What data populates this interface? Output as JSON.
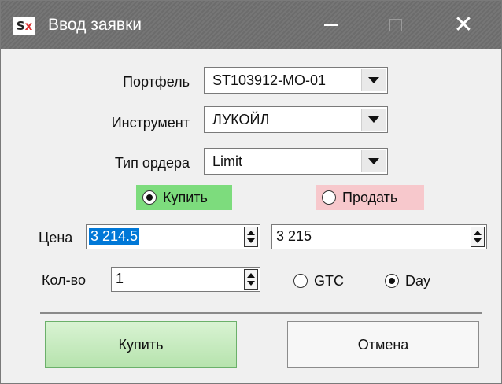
{
  "window": {
    "icon_text": "Sx",
    "title": "Ввод заявки"
  },
  "form": {
    "portfolio": {
      "label": "Портфель",
      "value": "ST103912-MO-01"
    },
    "instrument": {
      "label": "Инструмент",
      "value": "ЛУКОЙЛ"
    },
    "order_type": {
      "label": "Тип ордера",
      "value": "Limit"
    },
    "side": {
      "buy_label": "Купить",
      "sell_label": "Продать",
      "selected": "buy"
    },
    "price": {
      "label": "Цена",
      "value": "3 214.5",
      "value2": "3 215"
    },
    "quantity": {
      "label": "Кол-во",
      "value": "1"
    },
    "tif": {
      "gtc_label": "GTC",
      "day_label": "Day",
      "selected": "Day"
    }
  },
  "buttons": {
    "submit_label": "Купить",
    "cancel_label": "Отмена"
  },
  "colors": {
    "buy_highlight": "#7ddc7d",
    "sell_highlight": "#f7c8cc",
    "selection": "#0078d7",
    "titlebar": "#6f6f6f"
  }
}
